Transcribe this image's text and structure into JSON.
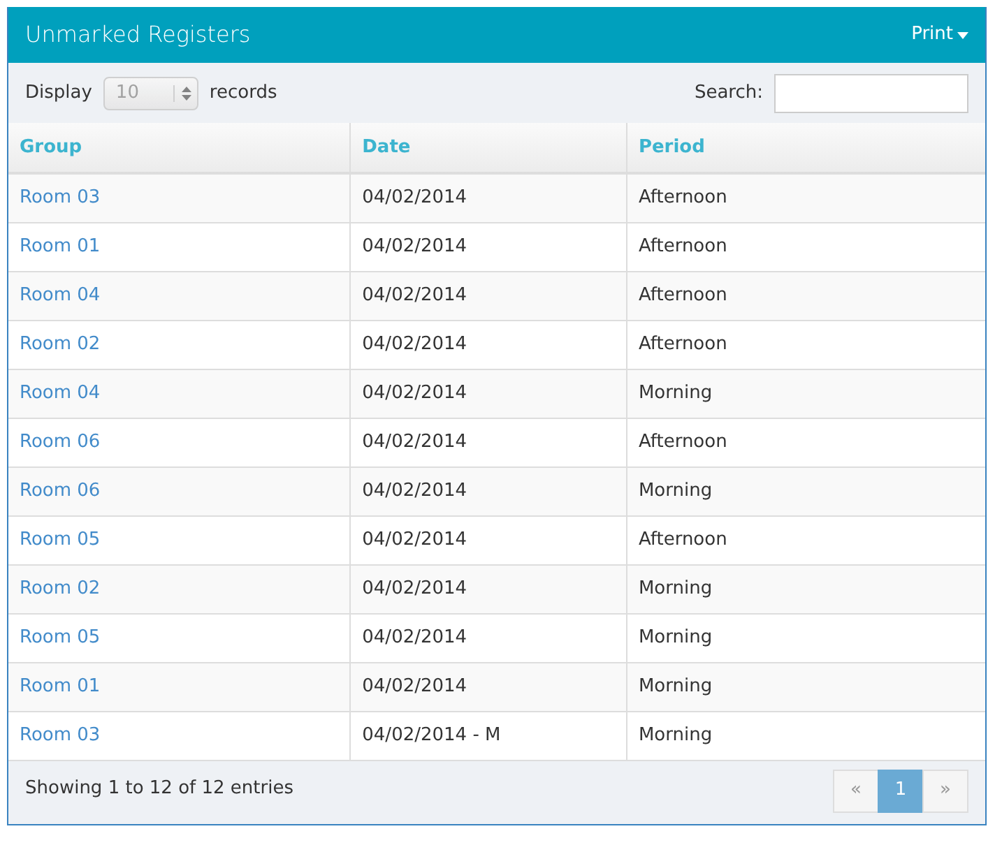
{
  "panel": {
    "title": "Unmarked Registers",
    "menu_label": "Print"
  },
  "length_control": {
    "label_before": "Display",
    "value": "10",
    "label_after": "records",
    "disabled": true
  },
  "search": {
    "label": "Search:"
  },
  "table": {
    "columns": [
      "Group",
      "Date",
      "Period"
    ],
    "rows": [
      {
        "cells": [
          "Room 03",
          "04/02/2014",
          "Afternoon"
        ]
      },
      {
        "cells": [
          "Room 01",
          "04/02/2014",
          "Afternoon"
        ]
      },
      {
        "cells": [
          "Room 04",
          "04/02/2014",
          "Afternoon"
        ]
      },
      {
        "cells": [
          "Room 02",
          "04/02/2014",
          "Afternoon"
        ]
      },
      {
        "cells": [
          "Room 04",
          "04/02/2014",
          "Morning"
        ]
      },
      {
        "cells": [
          "Room 06",
          "04/02/2014",
          "Afternoon"
        ]
      },
      {
        "cells": [
          "Room 06",
          "04/02/2014",
          "Morning"
        ]
      },
      {
        "cells": [
          "Room 05",
          "04/02/2014",
          "Afternoon"
        ]
      },
      {
        "cells": [
          "Room 02",
          "04/02/2014",
          "Morning"
        ]
      },
      {
        "cells": [
          "Room 05",
          "04/02/2014",
          "Morning"
        ]
      },
      {
        "cells": [
          "Room 01",
          "04/02/2014",
          "Morning"
        ]
      },
      {
        "cells": [
          "Room 03",
          "04/02/2014 - M",
          "Morning"
        ]
      }
    ]
  },
  "info": "Showing 1 to 12 of 12 entries",
  "pagination": [
    {
      "label": "«",
      "selected": false
    },
    {
      "label": "1",
      "selected": true
    },
    {
      "label": "»",
      "selected": false
    }
  ]
}
